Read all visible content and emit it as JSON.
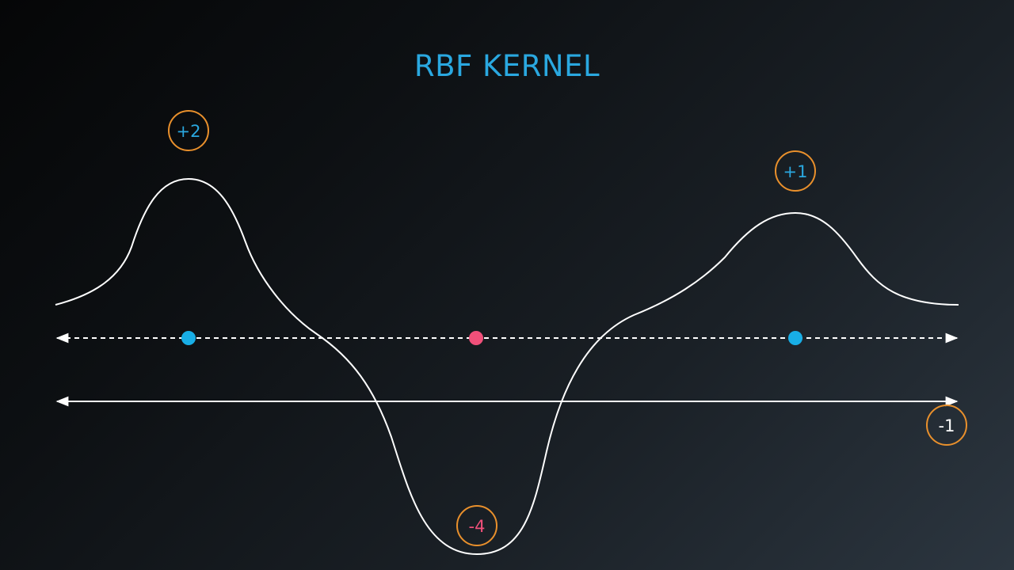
{
  "title": "RBF KERNEL",
  "colors": {
    "title": "#2aa8e0",
    "curve": "#ffffff",
    "axis": "#ffffff",
    "badge_ring": "#e9902c",
    "positive_point": "#18aee6",
    "negative_point": "#f0507a",
    "positive_label": "#2aa8e0",
    "negative_label": "#f0507a",
    "bias_label": "#ffffff"
  },
  "points": [
    {
      "id": "left",
      "class": "positive",
      "weight_label": "+2"
    },
    {
      "id": "middle",
      "class": "negative",
      "weight_label": "-4"
    },
    {
      "id": "right",
      "class": "positive",
      "weight_label": "+1"
    }
  ],
  "bias_label": "-1"
}
